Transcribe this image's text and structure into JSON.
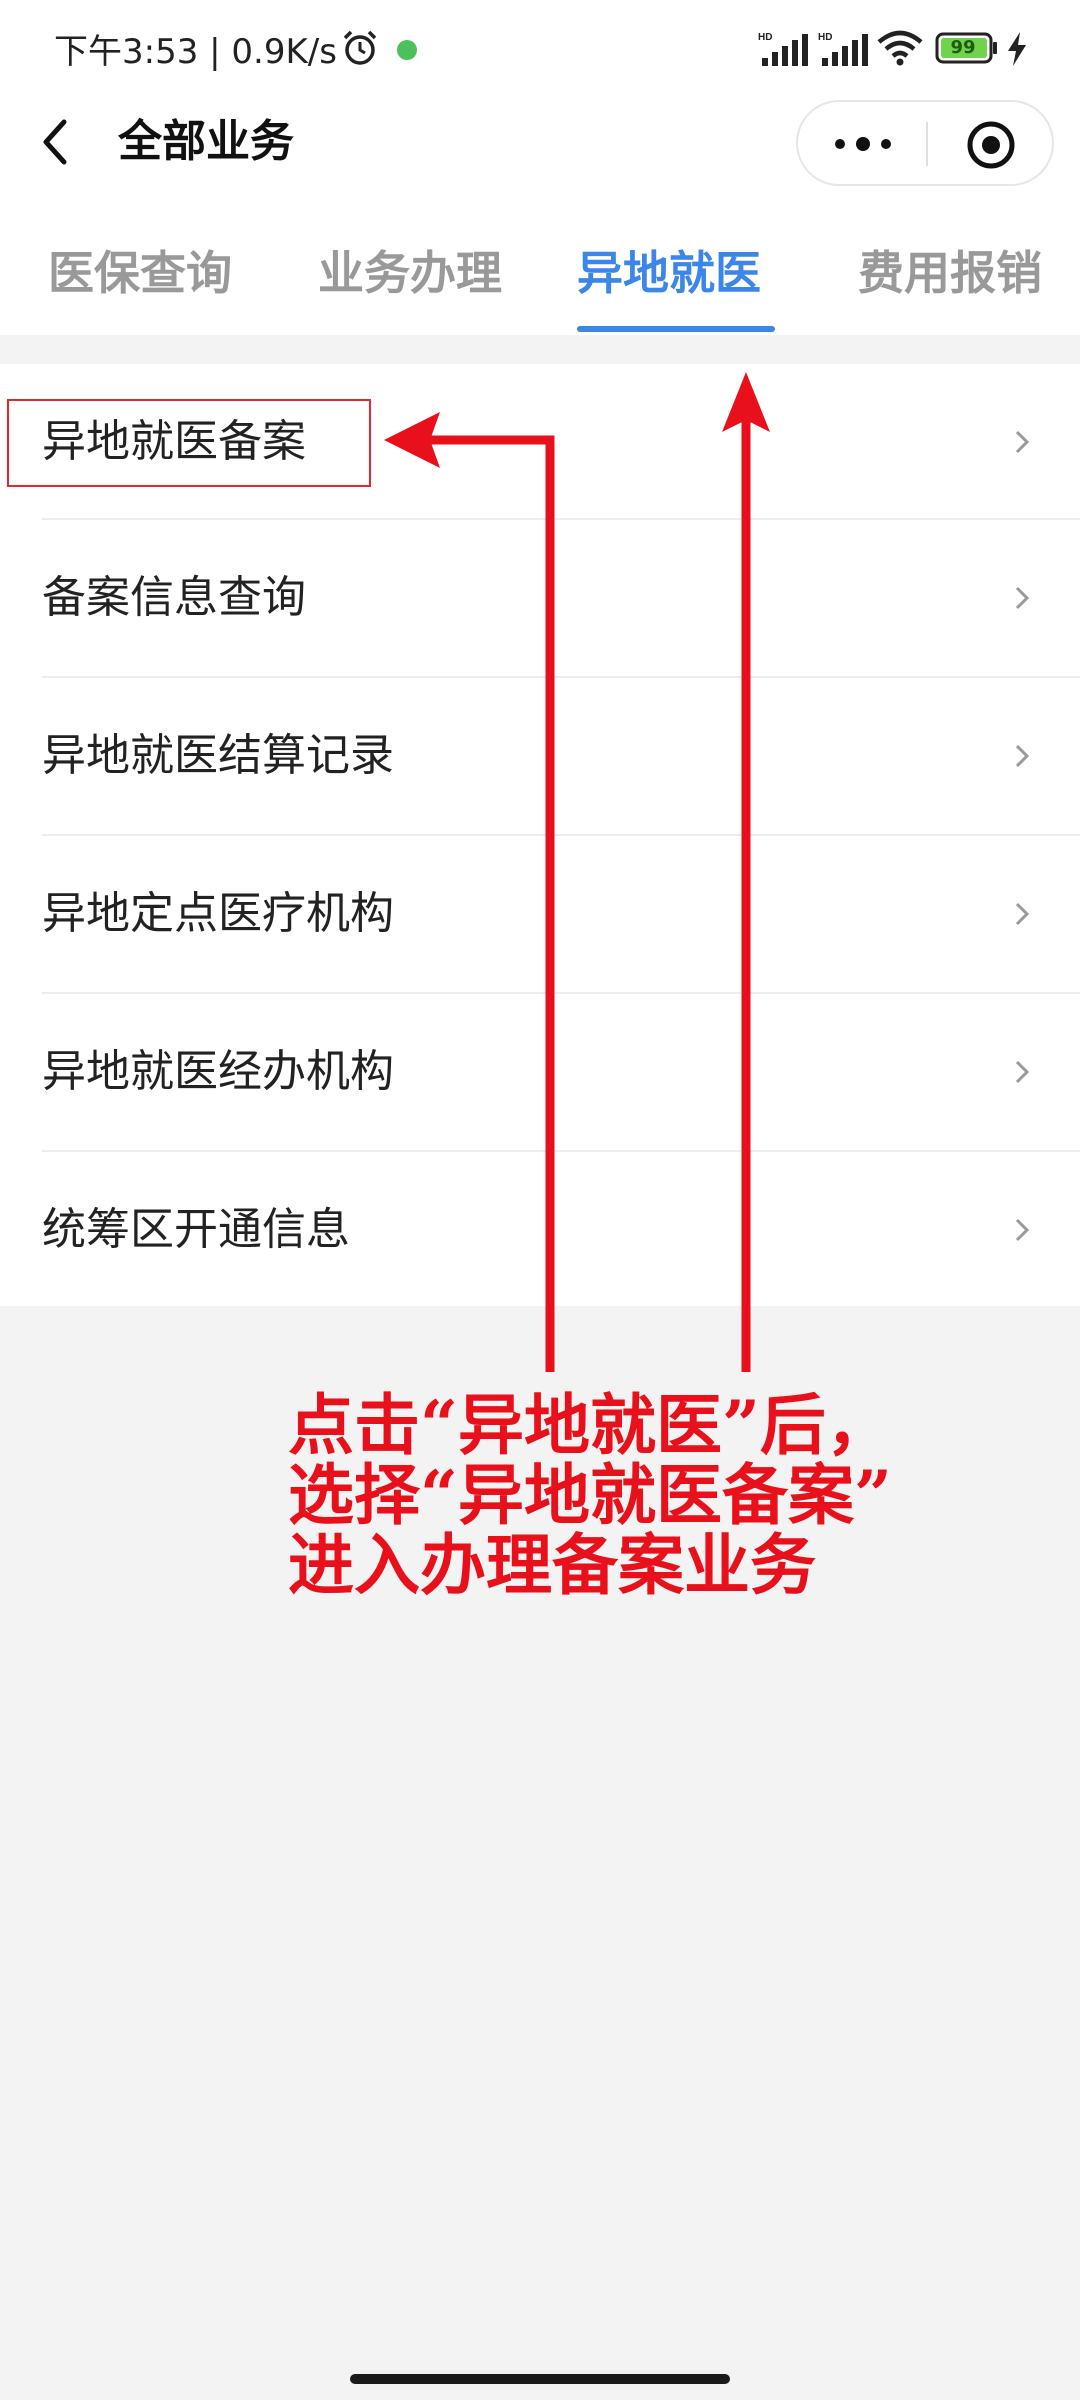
{
  "status_bar": {
    "time": "下午3:53 | 0.9K/s",
    "battery": "99",
    "icons": [
      "alarm-icon",
      "wechat-icon",
      "hd-signal-icon",
      "hd-signal-icon",
      "wifi-icon",
      "battery-icon",
      "charging-icon"
    ]
  },
  "nav": {
    "title": "全部业务",
    "icons": [
      "back-icon",
      "more-icon",
      "close-icon"
    ]
  },
  "tabs": [
    {
      "label": "医保查询"
    },
    {
      "label": "业务办理"
    },
    {
      "label": "异地就医"
    },
    {
      "label": "费用报销"
    }
  ],
  "active_tab": "异地就医",
  "list": {
    "items": [
      {
        "label": "异地就医备案"
      },
      {
        "label": "备案信息查询"
      },
      {
        "label": "异地就医结算记录"
      },
      {
        "label": "异地定点医疗机构"
      },
      {
        "label": "异地就医经办机构"
      },
      {
        "label": "统筹区开通信息"
      }
    ]
  },
  "annotation": {
    "line1": "点击“异地就医”后，",
    "line2": "选择“异地就医备案”",
    "line3": "进入办理备案业务"
  },
  "colors": {
    "accent": "#3b86e6",
    "annotation": "#e8101a",
    "background": "#f3f3f3"
  }
}
